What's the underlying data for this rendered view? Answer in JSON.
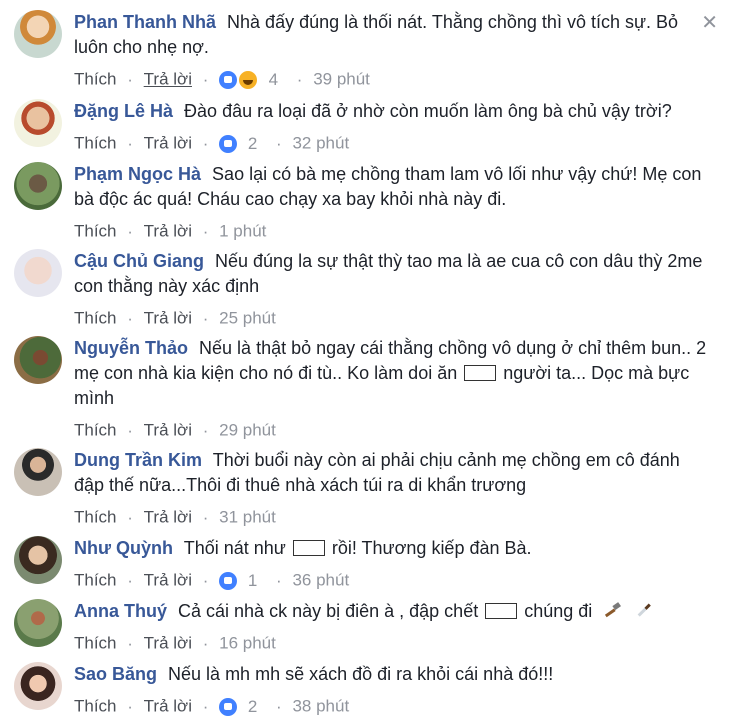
{
  "comments": [
    {
      "name": "Phan Thanh Nhã",
      "text": "Nhà đấy đúng là thối nát. Thằng chồng thì vô tích sự. Bỏ luôn cho nhẹ nợ.",
      "reactions": "4",
      "time": "39 phút",
      "like": "Thích",
      "reply": "Trả lời"
    },
    {
      "name": "Đặng Lê Hà",
      "text": "Đào đâu ra loại đã ở nhờ còn muốn làm ông bà chủ vậy trời?",
      "reactions": "2",
      "time": "32 phút",
      "like": "Thích",
      "reply": "Trả lời"
    },
    {
      "name": "Phạm Ngọc Hà",
      "text": "Sao lại có bà mẹ chồng tham lam vô lối như vậy chứ! Mẹ con bà độc ác quá! Cháu cao chạy xa bay khỏi nhà này đi.",
      "time": "1 phút",
      "like": "Thích",
      "reply": "Trả lời"
    },
    {
      "name": "Cậu Chủ Giang",
      "text": "Nếu đúng la sự thật thỳ tao ma là ae cua cô con dâu thỳ 2me con thằng này xác định",
      "time": "25 phút",
      "like": "Thích",
      "reply": "Trả lời"
    },
    {
      "name": "Nguyễn Thảo",
      "text_before": "Nếu là thật bỏ ngay cái thằng chồng vô dụng ở chỉ thêm bun.. 2 mẹ con nhà kia kiện cho nó đi tù.. Ko làm doi ăn",
      "text_after": "người ta... Dọc mà bực mình",
      "time": "29 phút",
      "like": "Thích",
      "reply": "Trả lời"
    },
    {
      "name": "Dung Trần Kim",
      "text": "Thời buổi này còn ai phải chịu cảnh mẹ chồng em cô đánh đập thế nữa...Thôi đi thuê nhà xách túi ra di khẩn trương",
      "time": "31 phút",
      "like": "Thích",
      "reply": "Trả lời"
    },
    {
      "name": "Như Quỳnh",
      "text_before": "Thối nát như",
      "text_after": "rồi! Thương kiếp đàn Bà.",
      "reactions": "1",
      "time": "36 phút",
      "like": "Thích",
      "reply": "Trả lời"
    },
    {
      "name": "Anna Thuý",
      "text_before": "Cả cái nhà ck này bị điên à , đập chết",
      "text_after": "chúng đi",
      "time": "16 phút",
      "like": "Thích",
      "reply": "Trả lời"
    },
    {
      "name": "Sao Băng",
      "text": "Nếu là mh mh sẽ xách đồ đi ra khỏi cái nhà đó!!!",
      "reactions": "2",
      "time": "38 phút",
      "like": "Thích",
      "reply": "Trả lời"
    }
  ],
  "close_icon": "close-icon",
  "colors": {
    "name": "#385898",
    "meta": "#90949c",
    "like_blue": "#4080ff"
  }
}
